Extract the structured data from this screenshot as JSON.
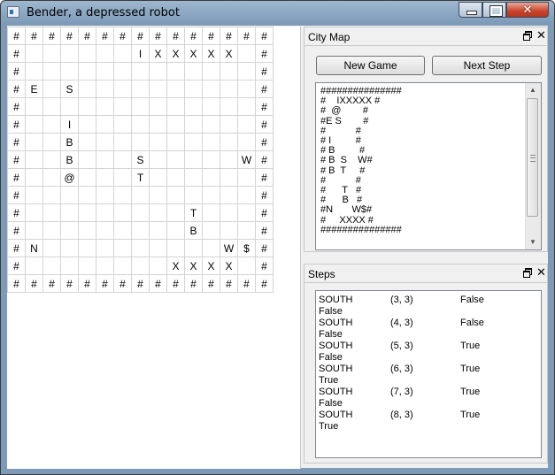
{
  "window": {
    "title": "Bender, a depressed robot",
    "close_glyph": "✕",
    "minimize_icon": "minimize-icon",
    "maximize_icon": "maximize-icon"
  },
  "grid": {
    "rows": [
      [
        "#",
        "#",
        "#",
        "#",
        "#",
        "#",
        "#",
        "#",
        "#",
        "#",
        "#",
        "#",
        "#",
        "#",
        "#"
      ],
      [
        "#",
        "",
        "",
        "",
        "",
        "",
        "",
        "I",
        "X",
        "X",
        "X",
        "X",
        "X",
        "",
        "#"
      ],
      [
        "#",
        "",
        "",
        "",
        "",
        "",
        "",
        "",
        "",
        "",
        "",
        "",
        "",
        "",
        "#"
      ],
      [
        "#",
        "E",
        "",
        "S",
        "",
        "",
        "",
        "",
        "",
        "",
        "",
        "",
        "",
        "",
        "#"
      ],
      [
        "#",
        "",
        "",
        "",
        "",
        "",
        "",
        "",
        "",
        "",
        "",
        "",
        "",
        "",
        "#"
      ],
      [
        "#",
        "",
        "",
        "I",
        "",
        "",
        "",
        "",
        "",
        "",
        "",
        "",
        "",
        "",
        "#"
      ],
      [
        "#",
        "",
        "",
        "B",
        "",
        "",
        "",
        "",
        "",
        "",
        "",
        "",
        "",
        "",
        "#"
      ],
      [
        "#",
        "",
        "",
        "B",
        "",
        "",
        "",
        "S",
        "",
        "",
        "",
        "",
        "",
        "W",
        "#"
      ],
      [
        "#",
        "",
        "",
        "@",
        "",
        "",
        "",
        "T",
        "",
        "",
        "",
        "",
        "",
        "",
        "#"
      ],
      [
        "#",
        "",
        "",
        "",
        "",
        "",
        "",
        "",
        "",
        "",
        "",
        "",
        "",
        "",
        "#"
      ],
      [
        "#",
        "",
        "",
        "",
        "",
        "",
        "",
        "",
        "",
        "",
        "T",
        "",
        "",
        "",
        "#"
      ],
      [
        "#",
        "",
        "",
        "",
        "",
        "",
        "",
        "",
        "",
        "",
        "B",
        "",
        "",
        "",
        "#"
      ],
      [
        "#",
        "N",
        "",
        "",
        "",
        "",
        "",
        "",
        "",
        "",
        "",
        "",
        "W",
        "$",
        "#"
      ],
      [
        "#",
        "",
        "",
        "",
        "",
        "",
        "",
        "",
        "",
        "X",
        "X",
        "X",
        "X",
        "",
        "#"
      ],
      [
        "#",
        "#",
        "#",
        "#",
        "#",
        "#",
        "#",
        "#",
        "#",
        "#",
        "#",
        "#",
        "#",
        "#",
        "#"
      ]
    ]
  },
  "city_map": {
    "title": "City Map",
    "new_game_label": "New Game",
    "next_step_label": "Next Step",
    "map_text": "###############\n#    IXXXXX #\n#  @        #\n#E S        #\n#           #\n# I         #\n# B         #\n# B  S    W#\n# B  T     #\n#           #\n#      T   #\n#      B   #\n#N       W$#\n#     XXXX #\n###############"
  },
  "steps": {
    "title": "Steps",
    "items": [
      {
        "direction": "SOUTH",
        "position": "(3, 3)",
        "flag1": "False",
        "flag2": "False"
      },
      {
        "direction": "SOUTH",
        "position": "(4, 3)",
        "flag1": "False",
        "flag2": "False"
      },
      {
        "direction": "SOUTH",
        "position": "(5, 3)",
        "flag1": "True",
        "flag2": "False"
      },
      {
        "direction": "SOUTH",
        "position": "(6, 3)",
        "flag1": "True",
        "flag2": "True"
      },
      {
        "direction": "SOUTH",
        "position": "(7, 3)",
        "flag1": "True",
        "flag2": "False"
      },
      {
        "direction": "SOUTH",
        "position": "(8, 3)",
        "flag1": "True",
        "flag2": "True"
      }
    ]
  },
  "colors": {
    "title_bar": "#7d9bb9",
    "close_button": "#c8432b",
    "panel_bg": "#f0f0f0",
    "grid_line": "#d4d4d4"
  }
}
